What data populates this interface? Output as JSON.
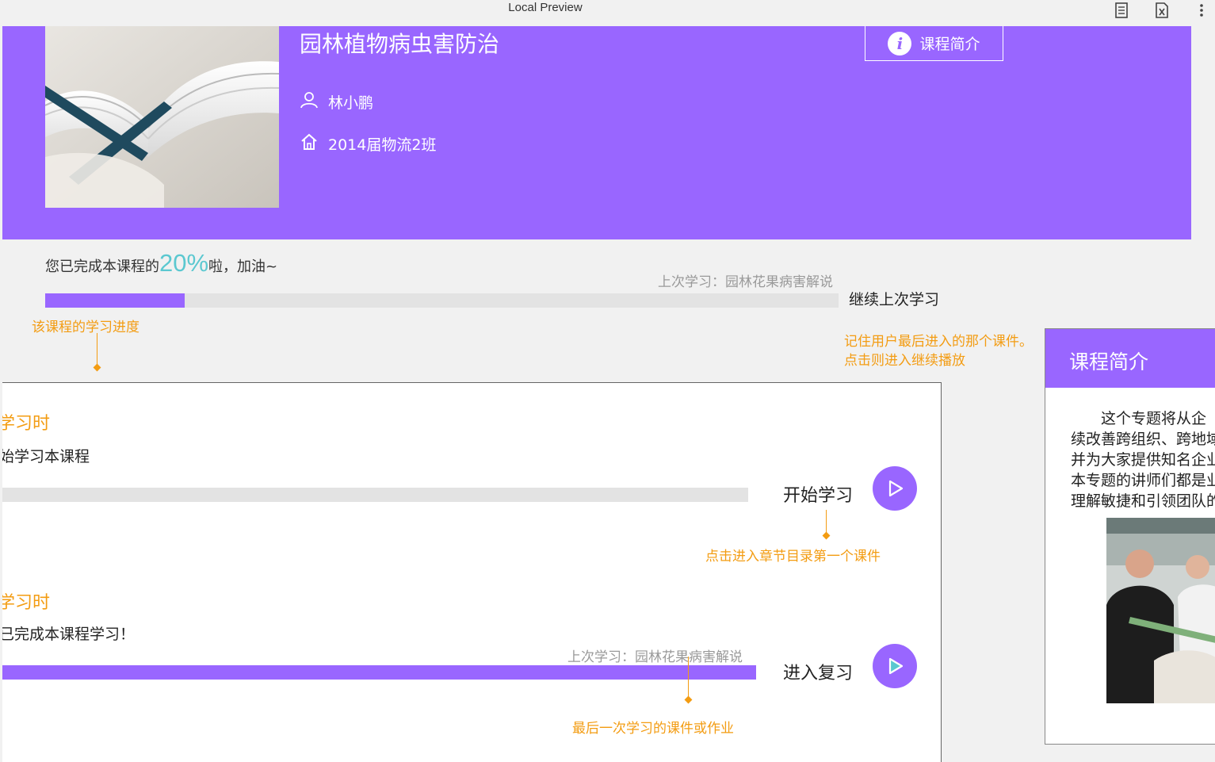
{
  "window": {
    "title": "Local Preview"
  },
  "header": {
    "course_title": "园林植物病虫害防治",
    "teacher": "林小鹏",
    "class_name": "2014届物流2班",
    "intro_button": "课程简介"
  },
  "progress": {
    "prefix": "您已完成本课程的",
    "percent_text": "20%",
    "suffix": "啦，加油~",
    "percent_value": 0.176,
    "last_study": "上次学习：园林花果病害解说",
    "continue_label": "继续上次学习"
  },
  "annotations": {
    "progress_note": "该课程的学习进度",
    "continue_note_line1": "记住用户最后进入的那个课件。",
    "continue_note_line2": "点击则进入继续播放",
    "start_note": "点击进入章节目录第一个课件",
    "review_note": "最后一次学习的课件或作业"
  },
  "card": {
    "section1_title": "学习时",
    "section1_text": "始学习本课程",
    "section1_progress": 0,
    "start_label": "开始学习",
    "section2_title": "学习时",
    "section2_text": "已完成本课程学习！",
    "section2_progress": 1,
    "section2_last_study": "上次学习：园林花果病害解说",
    "review_label": "进入复习"
  },
  "side_panel": {
    "title": "课程简介",
    "lines": [
      "　　这个专题将从企",
      "续改善跨组织、跨地域",
      "并为大家提供知名企业",
      "本专题的讲师们都是业",
      "理解敏捷和引领团队的"
    ]
  },
  "colors": {
    "accent": "#9966ff",
    "annotation": "#f39c12",
    "percent": "#5bc8d0",
    "play_triangle_review": "#5bc8d0"
  }
}
